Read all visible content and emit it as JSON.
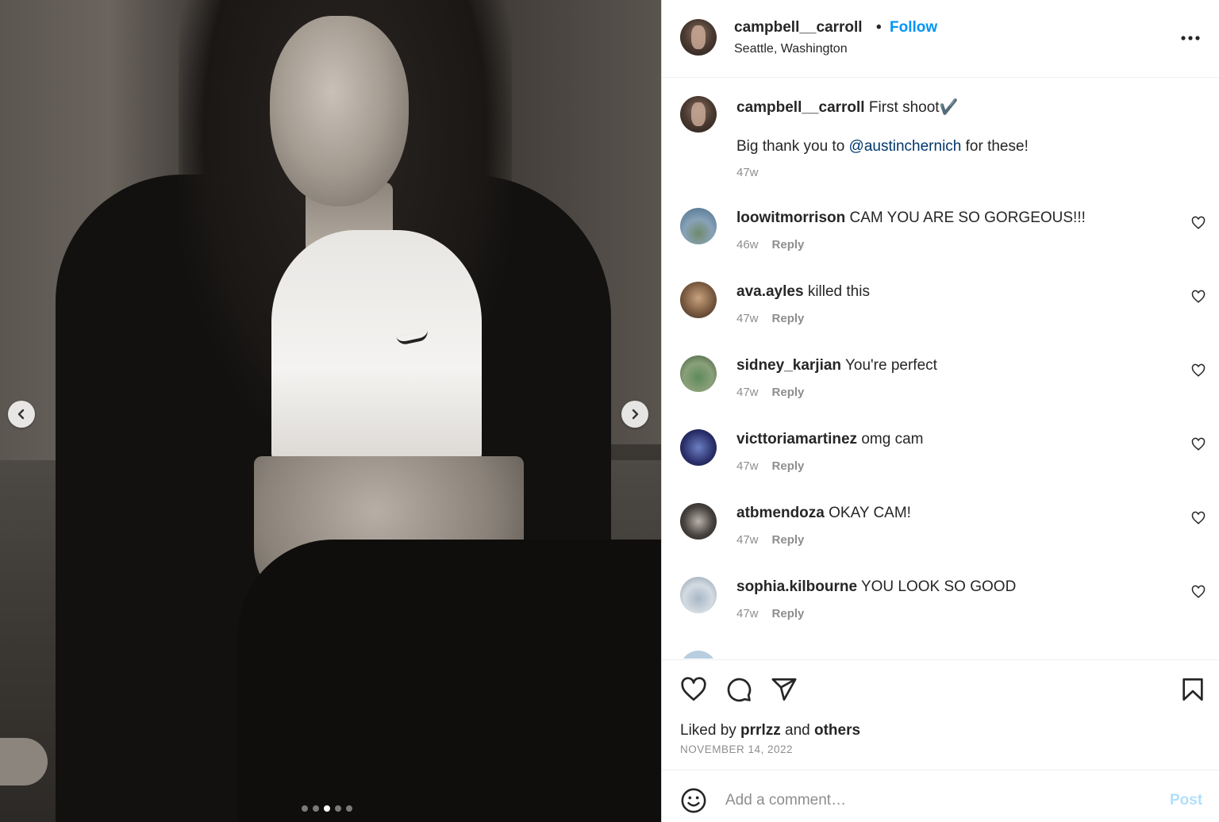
{
  "post": {
    "username": "campbell__carroll",
    "separator": "•",
    "follow_label": "Follow",
    "location": "Seattle, Washington",
    "more_icon": "more-horizontal-icon",
    "carousel": {
      "slide_count": 5,
      "active_index": 2
    }
  },
  "caption": {
    "username": "campbell__carroll",
    "text_line1": "First shoot✔️",
    "text_before_mention": "Big thank you to ",
    "mention": "@austinchernich",
    "text_after_mention": " for these!",
    "time": "47w"
  },
  "comments": [
    {
      "username": "loowitmorrison",
      "text": "CAM YOU ARE SO GORGEOUS!!!",
      "time": "46w",
      "reply": "Reply"
    },
    {
      "username": "ava.ayles",
      "text": "killed this",
      "time": "47w",
      "reply": "Reply"
    },
    {
      "username": "sidney_karjian",
      "text": "You're perfect",
      "time": "47w",
      "reply": "Reply"
    },
    {
      "username": "victtoriamartinez",
      "text": "omg cam",
      "time": "47w",
      "reply": "Reply"
    },
    {
      "username": "atbmendoza",
      "text": "OKAY CAM!",
      "time": "47w",
      "reply": "Reply"
    },
    {
      "username": "sophia.kilbourne",
      "text": "YOU LOOK SO GOOD",
      "time": "47w",
      "reply": "Reply"
    }
  ],
  "footer": {
    "liked_prefix": "Liked by ",
    "liked_user": "prrlzz",
    "liked_and": " and ",
    "liked_others": "others",
    "date": "NOVEMBER 14, 2022",
    "comment_placeholder": "Add a comment…",
    "post_label": "Post"
  },
  "colors": {
    "link_blue": "#0095f6",
    "mention_blue": "#00376b",
    "muted_text": "#8e8e8e",
    "post_disabled": "#b2dffc"
  }
}
